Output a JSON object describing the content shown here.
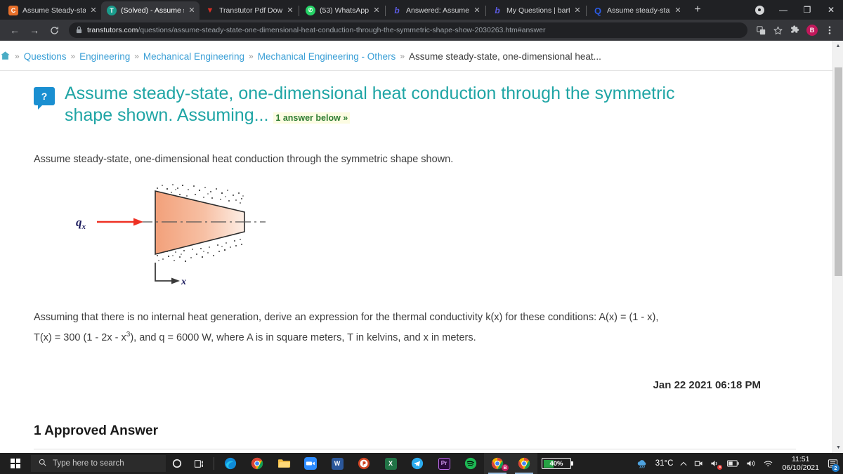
{
  "browser": {
    "tabs": [
      {
        "title": "Assume Steady-state,",
        "favicon_name": "chegg-icon",
        "favicon_letter": "C",
        "favicon_color": "#e8702a",
        "active": false
      },
      {
        "title": "(Solved) - Assume ste",
        "favicon_name": "transtutors-icon",
        "favicon_letter": "T",
        "favicon_color": "#1a9c8c",
        "active": true
      },
      {
        "title": "Transtutor Pdf Downlo",
        "favicon_name": "pdf-download-icon",
        "favicon_letter": "▼",
        "favicon_color": "#d93025",
        "active": false
      },
      {
        "title": "(53) WhatsApp",
        "favicon_name": "whatsapp-icon",
        "favicon_letter": "✆",
        "favicon_color": "#25d366",
        "active": false
      },
      {
        "title": "Answered: Assume ste",
        "favicon_name": "bartleby-icon",
        "favicon_letter": "b",
        "favicon_color": "#2b2b6b",
        "active": false
      },
      {
        "title": "My Questions | bartleb",
        "favicon_name": "bartleby-icon",
        "favicon_letter": "b",
        "favicon_color": "#2b2b6b",
        "active": false
      },
      {
        "title": "Assume steady-state,",
        "favicon_name": "quora-icon",
        "favicon_letter": "Q",
        "favicon_color": "#1a4ed8",
        "active": false
      }
    ],
    "new_tab_label": "+",
    "close_label": "✕",
    "window_controls": {
      "minimize": "—",
      "maximize": "❐",
      "close": "✕"
    },
    "nav": {
      "back": "←",
      "forward": "→",
      "reload": "C"
    },
    "address": {
      "lock_icon": "lock-icon",
      "host": "transtutors.com",
      "path": "/questions/assume-steady-state-one-dimensional-heat-conduction-through-the-symmetric-shape-show-2030263.htm#answer"
    },
    "toolbar_icons": [
      "translate-icon",
      "bookmark-star-icon",
      "extensions-puzzle-icon"
    ],
    "profile_initial": "B",
    "menu_icon": "kebab-menu-icon"
  },
  "breadcrumb": {
    "home_icon": "home-icon",
    "separator": "»",
    "items": [
      {
        "label": "Questions",
        "link": true
      },
      {
        "label": "Engineering",
        "link": true
      },
      {
        "label": "Mechanical Engineering",
        "link": true
      },
      {
        "label": "Mechanical Engineering - Others",
        "link": true
      },
      {
        "label": "Assume steady-state, one-dimensional heat...",
        "link": false
      }
    ]
  },
  "question": {
    "badge_glyph": "?",
    "title": "Assume steady-state, one-dimensional heat conduction through the symmetric shape shown. Assuming...",
    "answers_hint": "1 answer below »",
    "body": "Assume steady-state, one-dimensional heat conduction through the symmetric shape shown.",
    "conditions_line1": "Assuming that there is no internal heat generation, derive an expression for the thermal conductivity k(x) for these conditions: A(x) = (1 - x),",
    "conditions_line2_a": "T(x) = 300 (1 - 2x - x",
    "conditions_line2_sup": "3",
    "conditions_line2_b": "), and q = 6000 W, where A is in square meters, T in kelvins, and x in meters.",
    "date": "Jan 22 2021 06:18 PM",
    "figure": {
      "flux_label": "qx",
      "axis_label": "x",
      "shape_fill_light": "#fbdccb",
      "shape_fill_dark": "#f2a07a",
      "arrow_color": "#ee3124"
    }
  },
  "answer_section": {
    "heading": "1 Approved Answer"
  },
  "taskbar": {
    "start_icon": "windows-start-icon",
    "search_placeholder": "Type here to search",
    "search_icon": "search-icon",
    "cortana_icon": "cortana-circle-icon",
    "taskview_icon": "task-view-icon",
    "apps": [
      {
        "name": "microsoft-edge-icon",
        "letter": "e",
        "color": "#1b73bc",
        "running": false
      },
      {
        "name": "google-chrome-icon",
        "letter": "",
        "color": "#f4b400",
        "running": false
      },
      {
        "name": "file-explorer-icon",
        "letter": "",
        "color": "#f5b945",
        "running": false
      },
      {
        "name": "zoom-icon",
        "letter": "▭",
        "color": "#2d8cff",
        "running": false
      },
      {
        "name": "microsoft-word-icon",
        "letter": "W",
        "color": "#2b579a",
        "running": false
      },
      {
        "name": "microsoft-powerpoint-icon",
        "letter": "P",
        "color": "#d04423",
        "running": false
      },
      {
        "name": "microsoft-excel-icon",
        "letter": "X",
        "color": "#217346",
        "running": false
      },
      {
        "name": "telegram-icon",
        "letter": "➤",
        "color": "#2aabee",
        "running": false
      },
      {
        "name": "adobe-premiere-icon",
        "letter": "Pr",
        "color": "#2a0a3a",
        "running": false
      },
      {
        "name": "spotify-icon",
        "letter": "",
        "color": "#1db954",
        "running": false
      },
      {
        "name": "chrome-window-1-icon",
        "letter": "",
        "color": "#f4b400",
        "running": true
      },
      {
        "name": "chrome-window-2-icon",
        "letter": "",
        "color": "#f4b400",
        "running": true
      }
    ],
    "battery": {
      "percent_label": "40%",
      "percent_value": 40,
      "fill_color": "#26a244"
    },
    "weather": {
      "icon": "cloud-rain-icon",
      "temperature": "31°C"
    },
    "tray_icons": [
      "chevron-up-icon",
      "onedrive-icon",
      "speaker-mute-icon",
      "battery-icon",
      "volume-icon",
      "wifi-icon"
    ],
    "clock": {
      "time": "11:51",
      "date": "06/10/2021"
    },
    "notifications": {
      "icon": "action-center-icon",
      "count": "2"
    }
  }
}
